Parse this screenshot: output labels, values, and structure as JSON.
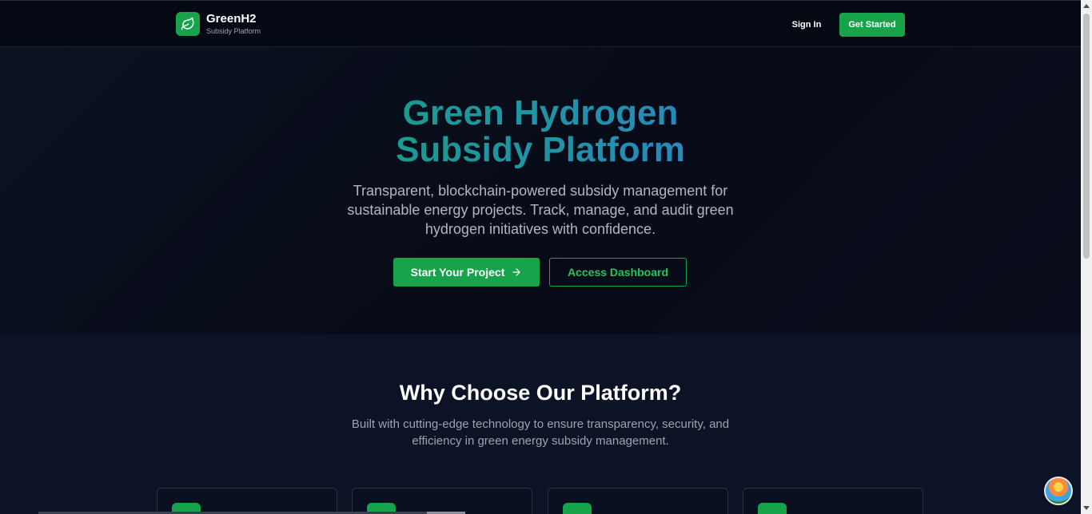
{
  "header": {
    "brand_name": "GreenH2",
    "brand_sub": "Subsidy Platform",
    "logo_icon": "leaf-icon",
    "signin_label": "Sign In",
    "get_started_label": "Get Started"
  },
  "hero": {
    "title_line1": "Green Hydrogen",
    "title_line2": "Subsidy Platform",
    "description": "Transparent, blockchain-powered subsidy management for sustainable energy projects. Track, manage, and audit green hydrogen initiatives with confidence.",
    "primary_button": "Start Your Project",
    "secondary_button": "Access Dashboard"
  },
  "features": {
    "title": "Why Choose Our Platform?",
    "description": "Built with cutting-edge technology to ensure transparency, security, and efficiency in green energy subsidy management."
  },
  "colors": {
    "accent": "#16a34a",
    "gradient_start": "#16a085",
    "gradient_end": "#2a86c6",
    "background": "#0b1020"
  }
}
